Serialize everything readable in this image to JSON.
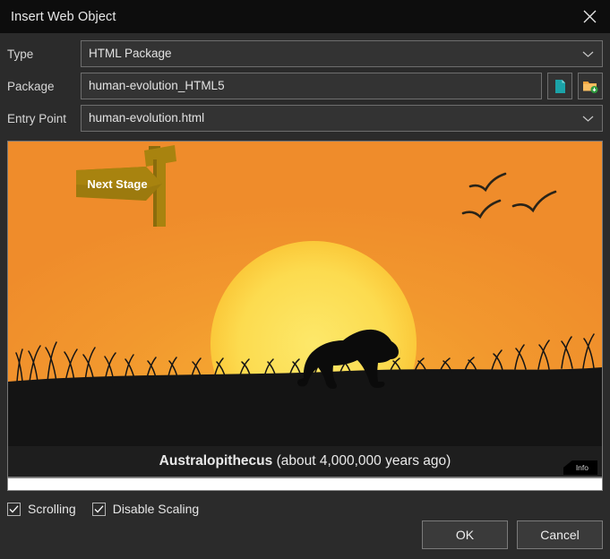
{
  "window": {
    "title": "Insert Web Object",
    "close_icon": "close-icon"
  },
  "form": {
    "type": {
      "label": "Type",
      "value": "HTML Package",
      "chevron_icon": "chevron-down-icon"
    },
    "package": {
      "label": "Package",
      "value": "human-evolution_HTML5",
      "document_button_icon": "document-icon",
      "browse_button_icon": "folder-download-icon"
    },
    "entry_point": {
      "label": "Entry Point",
      "value": "human-evolution.html",
      "chevron_icon": "chevron-down-icon"
    }
  },
  "preview": {
    "sign_label": "Next Stage",
    "caption_name": "Australopithecus",
    "caption_detail": " (about 4,000,000 years ago)",
    "info_tab_label": "Info",
    "colors": {
      "sky": "#F0912D",
      "sun_outer": "#FBCB3C",
      "sun_inner": "#FDE35C",
      "ground": "#111111",
      "sign_wood": "#9A7B10",
      "sign_post": "#A8830F",
      "panel_bg": "#1E1E1E"
    }
  },
  "options": {
    "scrolling": {
      "label": "Scrolling",
      "checked": true,
      "check_icon": "checkmark-icon"
    },
    "disable_scaling": {
      "label": "Disable Scaling",
      "checked": true,
      "check_icon": "checkmark-icon"
    }
  },
  "footer": {
    "ok_label": "OK",
    "cancel_label": "Cancel"
  }
}
